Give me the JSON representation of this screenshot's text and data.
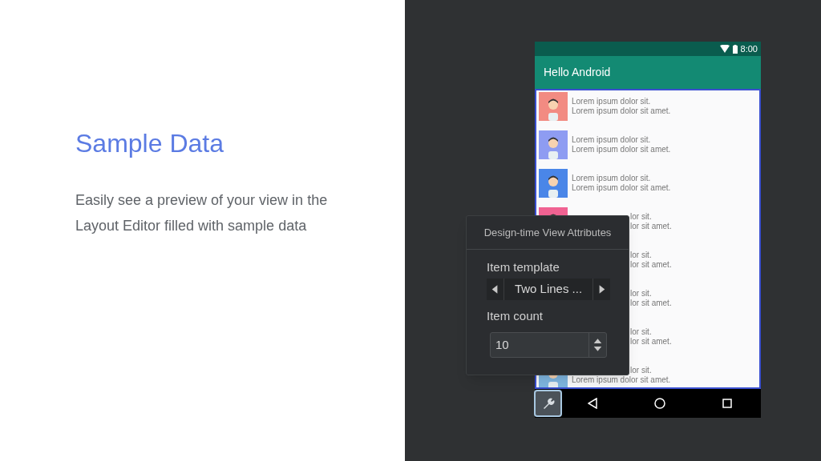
{
  "slide": {
    "title": "Sample Data",
    "body": "Easily see a preview of your view in the Layout Editor filled with sample data"
  },
  "phone": {
    "status_bar": {
      "time": "8:00"
    },
    "app_bar": {
      "title": "Hello Android"
    },
    "rows": [
      {
        "color": "#f28b82",
        "lines": [
          {
            "text": "Lorem ipsum dolor sit.",
            "kind": "full"
          },
          {
            "text": "Lorem ipsum dolor sit amet.",
            "kind": "full"
          }
        ]
      },
      {
        "color": "#8e9cf2",
        "lines": [
          {
            "text": "Lorem ipsum dolor sit.",
            "kind": "full"
          },
          {
            "text": "Lorem ipsum dolor sit amet.",
            "kind": "full"
          }
        ]
      },
      {
        "color": "#4a86e8",
        "lines": [
          {
            "text": "Lorem ipsum dolor sit.",
            "kind": "full"
          },
          {
            "text": "Lorem ipsum dolor sit amet.",
            "kind": "full"
          }
        ]
      },
      {
        "color": "#f06292",
        "lines": [
          {
            "text": "lor sit.",
            "kind": "fragment"
          },
          {
            "text": "lor sit amet.",
            "kind": "fragment"
          }
        ]
      },
      {
        "lines": [
          {
            "text": "lor sit.",
            "kind": "fragment"
          },
          {
            "text": "lor sit amet.",
            "kind": "fragment"
          }
        ]
      },
      {
        "lines": [
          {
            "text": "lor sit.",
            "kind": "fragment"
          },
          {
            "text": "lor sit amet.",
            "kind": "fragment"
          }
        ]
      },
      {
        "lines": [
          {
            "text": "lor sit.",
            "kind": "fragment"
          },
          {
            "text": "lor sit amet.",
            "kind": "fragment"
          }
        ]
      },
      {
        "color": "#7fb6e0",
        "lines": [
          {
            "text": "lor sit.",
            "kind": "fragment"
          },
          {
            "text": "Lorem ipsum dolor sit amet.",
            "kind": "full"
          }
        ]
      }
    ]
  },
  "popup": {
    "title": "Design-time View Attributes",
    "template_label": "Item template",
    "template_value": "Two Lines ...",
    "count_label": "Item count",
    "count_value": "10"
  }
}
